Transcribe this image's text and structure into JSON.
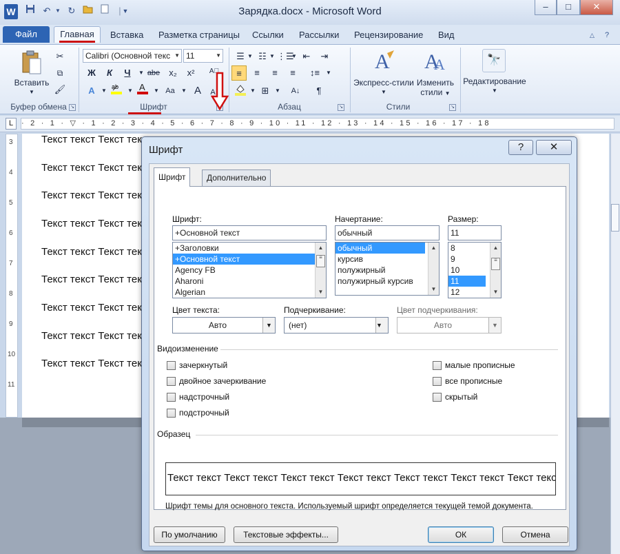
{
  "window": {
    "title": "Зарядка.docx - Microsoft Word",
    "app_logo": "W",
    "controls": {
      "minimize": "–",
      "maximize": "□",
      "close": "✕"
    }
  },
  "quick_access": [
    "save-icon",
    "undo-icon",
    "redo-icon",
    "open-icon",
    "new-icon"
  ],
  "tabs": [
    {
      "label": "Файл"
    },
    {
      "label": "Главная"
    },
    {
      "label": "Вставка"
    },
    {
      "label": "Разметка страницы"
    },
    {
      "label": "Ссылки"
    },
    {
      "label": "Рассылки"
    },
    {
      "label": "Рецензирование"
    },
    {
      "label": "Вид"
    }
  ],
  "ribbon": {
    "clipboard": {
      "paste_label": "Вставить",
      "group_label": "Буфер обмена"
    },
    "font": {
      "font_name": "Calibri (Основной текс",
      "font_size": "11",
      "group_label": "Шрифт",
      "bold": "Ж",
      "italic": "К",
      "underline": "Ч",
      "strike": "abe",
      "subscript": "x₂",
      "superscript": "x²",
      "grow": "A",
      "shrink": "A",
      "case": "Aa"
    },
    "paragraph": {
      "group_label": "Абзац",
      "pilcrow": "¶"
    },
    "styles": {
      "express_label": "Экспресс-стили",
      "change_label_1": "Изменить",
      "change_label_2": "стили",
      "group_label": "Стили"
    },
    "editing": {
      "label": "Редактирование"
    }
  },
  "ruler": {
    "corner": "L",
    "ticks": "· 2 · 1 · ▽ · 1 · 2 · 3 · 4 · 5 · 6 · 7 · 8 · 9 · 10 · 11 · 12 · 13 · 14 · 15 · 16 · 17 · 18",
    "vertical": [
      "3",
      "4",
      "5",
      "6",
      "7",
      "8",
      "9",
      "10",
      "11"
    ]
  },
  "document": {
    "lines": [
      "Текст текст Текст текст",
      "Текст текст Текст текст",
      "Текст текст Текст текст",
      "Текст текст Текст текст",
      "Текст текст Текст текст",
      "Текст текст Текст текст",
      "Текст текст Текст текст",
      "Текст текст Текст текст",
      "Текст текст Текст текст"
    ]
  },
  "dialog": {
    "title": "Шрифт",
    "help": "?",
    "close": "✕",
    "tabs": {
      "font": "Шрифт",
      "advanced": "Дополнительно"
    },
    "font_label": "Шрифт:",
    "font_value": "+Основной текст",
    "font_list": [
      "+Заголовки",
      "+Основной текст",
      "Agency FB",
      "Aharoni",
      "Algerian"
    ],
    "font_selected_index": 1,
    "style_label": "Начертание:",
    "style_value": "обычный",
    "style_list": [
      "обычный",
      "курсив",
      "полужирный",
      "полужирный курсив"
    ],
    "style_selected_index": 0,
    "size_label": "Размер:",
    "size_value": "11",
    "size_list": [
      "8",
      "9",
      "10",
      "11",
      "12"
    ],
    "size_selected_index": 3,
    "color_label": "Цвет текста:",
    "color_value": "Авто",
    "underline_label": "Подчеркивание:",
    "underline_value": "(нет)",
    "underline_color_label": "Цвет подчеркивания:",
    "underline_color_value": "Авто",
    "effects_label": "Видоизменение",
    "effects_left": [
      "зачеркнутый",
      "двойное зачеркивание",
      "надстрочный",
      "подстрочный"
    ],
    "effects_right": [
      "малые прописные",
      "все прописные",
      "скрытый"
    ],
    "sample_label": "Образец",
    "sample_text": "Текст текст Текст текст Текст текст Текст текст Текст текст Текст текст Текст текст",
    "hint": "Шрифт темы для основного текста. Используемый шрифт определяется текущей темой документа.",
    "buttons": {
      "default": "По умолчанию",
      "effects": "Текстовые эффекты...",
      "ok": "ОК",
      "cancel": "Отмена"
    }
  },
  "colors": {
    "accent_blue": "#2d64b4",
    "selection": "#3399ff",
    "annotation_red": "#cc1010"
  }
}
